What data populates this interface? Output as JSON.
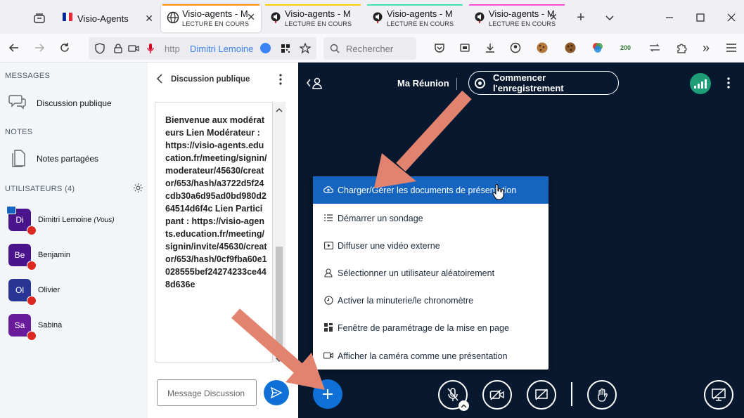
{
  "browser": {
    "tabs": [
      {
        "title": "Visio-Agents",
        "sub": ""
      },
      {
        "title": "Visio-agents - M",
        "sub": "LECTURE EN COURS"
      },
      {
        "title": "Visio-agents - M",
        "sub": "LECTURE EN COURS"
      },
      {
        "title": "Visio-agents - M",
        "sub": "LECTURE EN COURS"
      },
      {
        "title": "Visio-agents - M",
        "sub": "LECTURE EN COURS"
      }
    ],
    "tab_line_colors": [
      "#ff9400",
      "#ffcb00",
      "#3fe1b0",
      "#37adff",
      "#ff4bda"
    ],
    "url_prefix": "http",
    "url_user": "Dimitri Lemoine",
    "search_placeholder": "Rechercher",
    "badge_200": "200"
  },
  "sidebar": {
    "messages_header": "MESSAGES",
    "public_chat": "Discussion publique",
    "notes_header": "NOTES",
    "shared_notes": "Notes partagées",
    "users_header": "UTILISATEURS (4)",
    "users": [
      {
        "initials": "Di",
        "name": "Dimitri Lemoine",
        "suffix": "(Vous)",
        "color": "#4a148c"
      },
      {
        "initials": "Be",
        "name": "Benjamin",
        "suffix": "",
        "color": "#4a148c"
      },
      {
        "initials": "Ol",
        "name": "Olivier",
        "suffix": "",
        "color": "#283593"
      },
      {
        "initials": "Sa",
        "name": "Sabina",
        "suffix": "",
        "color": "#6a1b9a"
      }
    ]
  },
  "chat": {
    "title": "Discussion publique",
    "message": "Bienvenue aux modérateurs Lien Modérateur : https://visio-agents.education.fr/meeting/signin/moderateur/45630/creator/653/hash/a3722d5f24cdb30a6d95ad0bd980d264514d6f4c Lien Participant : https://visio-agents.education.fr/meeting/signin/invite/45630/creator/653/hash/0cf9fba60e1028555bef24274233ce448d636e",
    "input_placeholder": "Message Discussion"
  },
  "main": {
    "meeting_title": "Ma Réunion",
    "record_label": "Commencer l'enregistrement",
    "menu_items": [
      {
        "label": "Charger/Gérer les documents de présentation",
        "icon": "upload-cloud-icon"
      },
      {
        "label": "Démarrer un sondage",
        "icon": "poll-icon"
      },
      {
        "label": "Diffuser une vidéo externe",
        "icon": "video-icon"
      },
      {
        "label": "Sélectionner un utilisateur aléatoirement",
        "icon": "user-icon"
      },
      {
        "label": "Activer la minuterie/le chronomètre",
        "icon": "timer-icon"
      },
      {
        "label": "Fenêtre de paramétrage de la mise en page",
        "icon": "layout-icon"
      },
      {
        "label": "Afficher la caméra comme une présentation",
        "icon": "camera-icon"
      }
    ]
  },
  "colors": {
    "accent": "#0f70d7",
    "dark_bg": "#07182f",
    "arrow": "#e2836f",
    "menu_active": "#1565c0"
  }
}
